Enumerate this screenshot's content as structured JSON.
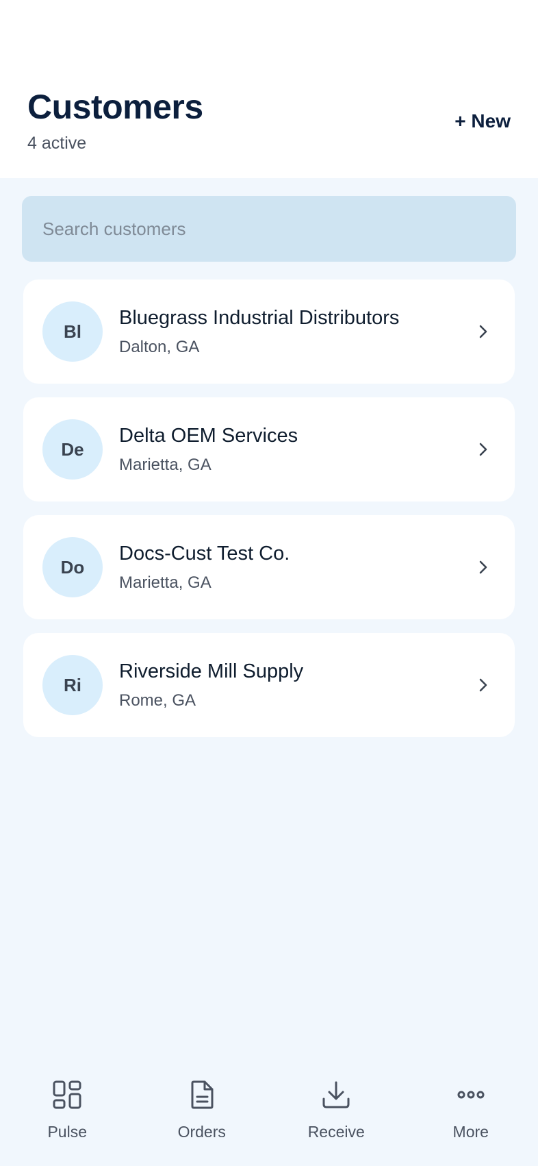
{
  "header": {
    "title": "Customers",
    "subtitle": "4 active",
    "new_label": "+ New"
  },
  "search": {
    "placeholder": "Search customers",
    "value": ""
  },
  "customers": [
    {
      "initials": "Bl",
      "name": "Bluegrass Industrial Distributors",
      "location": "Dalton, GA"
    },
    {
      "initials": "De",
      "name": "Delta OEM Services",
      "location": "Marietta, GA"
    },
    {
      "initials": "Do",
      "name": "Docs-Cust Test Co.",
      "location": "Marietta, GA"
    },
    {
      "initials": "Ri",
      "name": "Riverside Mill Supply",
      "location": "Rome, GA"
    }
  ],
  "tabbar": {
    "tabs": [
      {
        "label": "Pulse",
        "icon": "grid-icon"
      },
      {
        "label": "Orders",
        "icon": "document-icon"
      },
      {
        "label": "Receive",
        "icon": "download-icon"
      },
      {
        "label": "More",
        "icon": "more-dots-icon"
      }
    ]
  },
  "colors": {
    "background": "#f1f7fd",
    "header": "#ffffff",
    "title": "#0c1f3d",
    "search_bg": "#cfe4f2",
    "avatar_bg": "#d9eefc",
    "muted_text": "#4a5260"
  }
}
